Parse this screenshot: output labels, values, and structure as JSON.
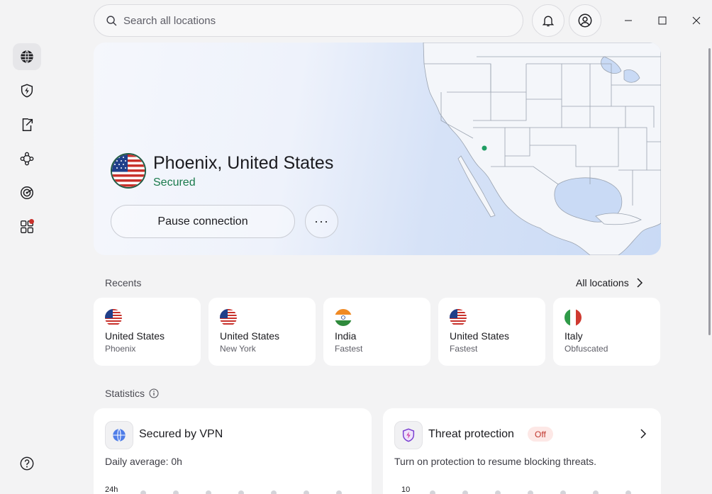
{
  "search": {
    "placeholder": "Search all locations"
  },
  "sidebar": {
    "items": [
      {
        "name": "globe-icon"
      },
      {
        "name": "threat-protection-icon"
      },
      {
        "name": "split-tunnel-icon"
      },
      {
        "name": "meshnet-icon"
      },
      {
        "name": "dark-web-monitor-icon"
      },
      {
        "name": "apps-icon"
      }
    ],
    "help": "help-icon"
  },
  "connection": {
    "location": "Phoenix, United States",
    "status": "Secured",
    "pause_label": "Pause connection",
    "more_label": "···"
  },
  "recents": {
    "label": "Recents",
    "all_locations": "All locations",
    "items": [
      {
        "country": "United States",
        "sub": "Phoenix",
        "flag": "us"
      },
      {
        "country": "United States",
        "sub": "New York",
        "flag": "us"
      },
      {
        "country": "India",
        "sub": "Fastest",
        "flag": "in"
      },
      {
        "country": "United States",
        "sub": "Fastest",
        "flag": "us"
      },
      {
        "country": "Italy",
        "sub": "Obfuscated",
        "flag": "it"
      }
    ]
  },
  "statistics": {
    "label": "Statistics",
    "vpn": {
      "title": "Secured by VPN",
      "daily_label": "Daily average: ",
      "daily_value": "0h",
      "axis_top": "24h"
    },
    "threat": {
      "title": "Threat protection",
      "badge": "Off",
      "desc": "Turn on protection to resume blocking threats.",
      "axis_top": "10"
    }
  },
  "colors": {
    "accent_green": "#1a7a4c",
    "badge_red": "#c0352c",
    "map_blue": "#c9daf5"
  }
}
